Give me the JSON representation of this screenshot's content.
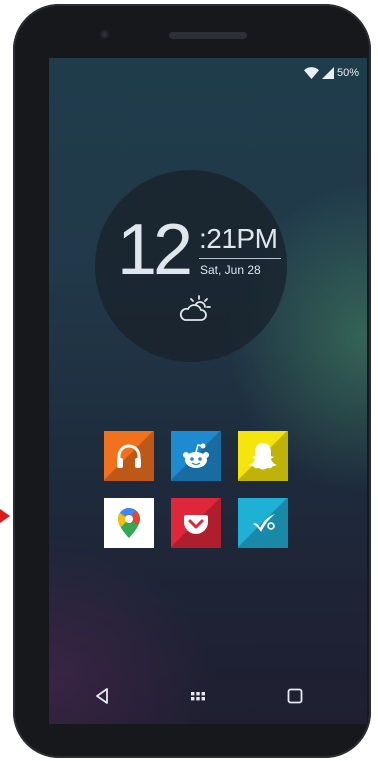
{
  "status_bar": {
    "battery_percent": "50%",
    "icons": [
      "wifi-icon",
      "cell-signal-icon"
    ]
  },
  "clock_widget": {
    "hour": "12",
    "minutes_ampm": ":21PM",
    "date": "Sat, Jun 28",
    "weather_icon": "partly-cloudy-icon"
  },
  "apps": [
    {
      "name": "Google Play Music",
      "icon": "headphones-icon",
      "color": "#f2711c"
    },
    {
      "name": "Reddit",
      "icon": "reddit-alien-icon",
      "color": "#1e8ad0"
    },
    {
      "name": "Snapchat",
      "icon": "ghost-icon",
      "color": "#f5e50c"
    },
    {
      "name": "Google Maps",
      "icon": "maps-pin-icon",
      "color": "#ffffff"
    },
    {
      "name": "Pocket",
      "icon": "pocket-icon",
      "color": "#e0263a"
    },
    {
      "name": "Tasks",
      "icon": "checkmark-icon",
      "color": "#1fb0d6"
    }
  ],
  "nav_bar": {
    "icons": [
      "back-icon",
      "app-drawer-icon",
      "recents-icon"
    ]
  },
  "colors": {
    "phone_body": "#16181c",
    "arrow": "#e01a1a"
  }
}
